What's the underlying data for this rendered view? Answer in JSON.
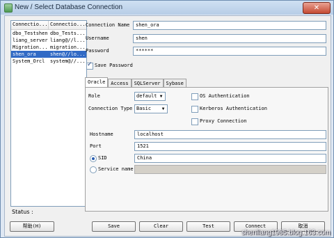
{
  "window": {
    "title": "New / Select Database Connection",
    "close_glyph": "✕"
  },
  "connections": {
    "headers": [
      "Connectio...",
      "Connectio..."
    ],
    "rows": [
      [
        "dbo_Testshen",
        "dbo_Tests..."
      ],
      [
        "liang_server",
        "liang@//l..."
      ],
      [
        "Migration...",
        "migration..."
      ],
      [
        "shen_ora",
        "shen@//lo..."
      ],
      [
        "System_Orcl",
        "system@//..."
      ]
    ],
    "selected_index": 3
  },
  "form": {
    "connection_name": {
      "label": "Connection Name",
      "value": "shen_ora"
    },
    "username": {
      "label": "Username",
      "value": "shen"
    },
    "password": {
      "label": "Password",
      "value": "******"
    },
    "save_password": {
      "label": "Save Password",
      "checked": true
    }
  },
  "tabs": [
    "Oracle",
    "Access",
    "SQLServer",
    "Sybase"
  ],
  "oracle": {
    "role": {
      "label": "Role",
      "value": "default"
    },
    "connection_type": {
      "label": "Connection Type",
      "value": "Basic"
    },
    "os_auth": {
      "label": "OS Authentication",
      "checked": false
    },
    "kerberos_auth": {
      "label": "Kerberos Authentication",
      "checked": false
    },
    "proxy": {
      "label": "Proxy Connection",
      "checked": false
    },
    "hostname": {
      "label": "Hostname",
      "value": "localhost"
    },
    "port": {
      "label": "Port",
      "value": "1521"
    },
    "sid": {
      "label": "SID",
      "value": "China",
      "selected": true
    },
    "service_name": {
      "label": "Service name",
      "value": ""
    }
  },
  "status": {
    "label": "Status :"
  },
  "buttons": {
    "help": "帮助(H)",
    "save": "Save",
    "clear": "Clear",
    "test": "Test",
    "connect": "Connect",
    "cancel": "取消"
  },
  "watermark": "shenliang1985.blog.163.com"
}
